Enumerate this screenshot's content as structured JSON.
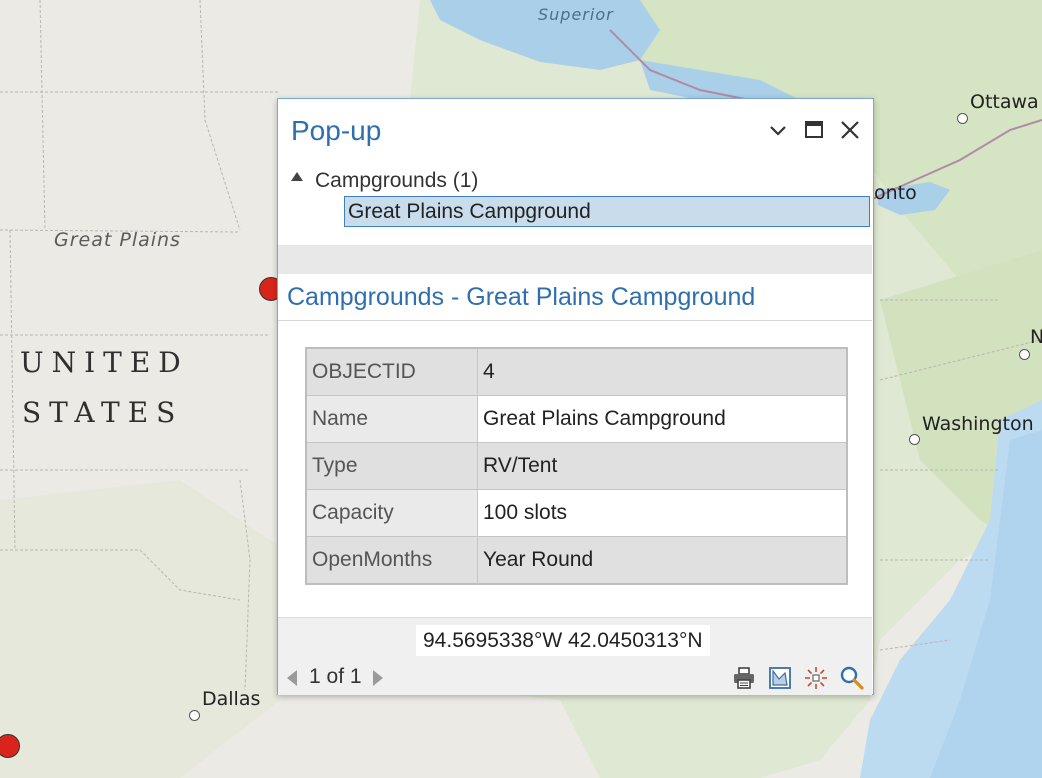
{
  "map": {
    "labels": {
      "lake_superior": "Superior",
      "ottawa": "Ottawa",
      "toronto_partial": "onto",
      "great_plains": "Great Plains",
      "united": "UNITED",
      "states": "STATES",
      "washington": "Washington",
      "ny_partial": "N",
      "dallas": "Dallas"
    },
    "colors": {
      "land": "#eceae4",
      "water": "#a9cfe9",
      "ocean": "#bcdaf0",
      "forest": "#d7e6c6",
      "campground": "#d9241c"
    }
  },
  "popup": {
    "title": "Pop-up",
    "window_buttons": [
      "chevron-down-icon",
      "maximize-icon",
      "close-icon"
    ],
    "tree": {
      "group_label": "Campgrounds (1)",
      "feature_label": "Great Plains Campground"
    },
    "detail_title": "Campgrounds - Great Plains Campground",
    "attributes": [
      {
        "key": "OBJECTID",
        "value": "4"
      },
      {
        "key": "Name",
        "value": "Great Plains Campground"
      },
      {
        "key": "Type",
        "value": "RV/Tent"
      },
      {
        "key": "Capacity",
        "value": "100 slots"
      },
      {
        "key": "OpenMonths",
        "value": "Year Round"
      }
    ],
    "coordinates": "94.5695338°W 42.0450313°N",
    "navigation": {
      "text": "1 of 1"
    },
    "tools": [
      "print-icon",
      "zoom-to-icon",
      "flash-icon",
      "search-icon"
    ]
  }
}
